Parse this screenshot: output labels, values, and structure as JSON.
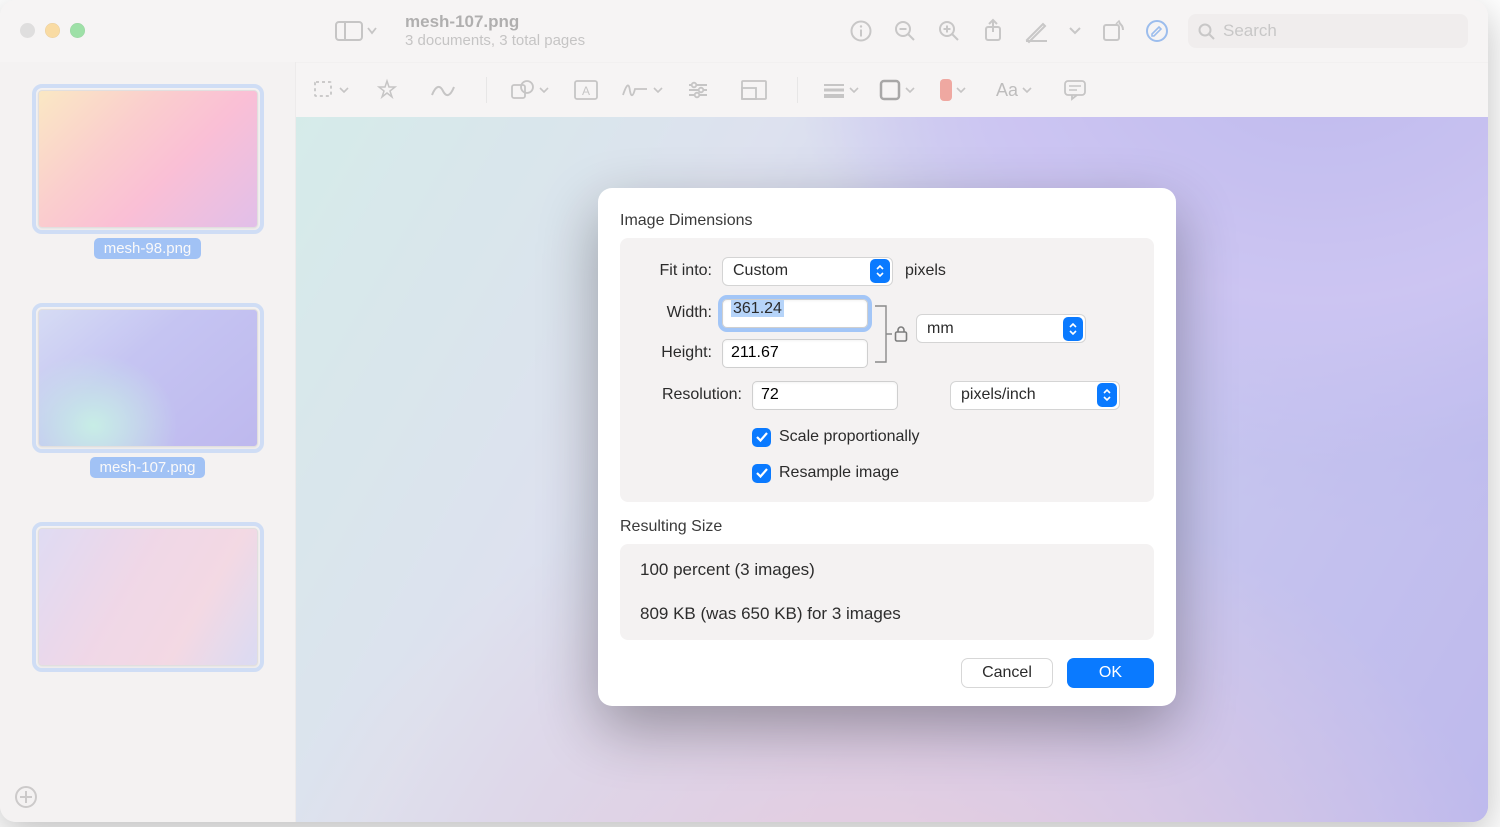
{
  "window": {
    "filename": "mesh-107.png",
    "subtitle": "3 documents, 3 total pages"
  },
  "toolbar_right": {
    "search_placeholder": "Search"
  },
  "sidebar": {
    "thumbs": [
      {
        "label": "mesh-98.png"
      },
      {
        "label": "mesh-107.png"
      },
      {
        "label": ""
      }
    ]
  },
  "dialog": {
    "section1_title": "Image Dimensions",
    "fit_into_label": "Fit into:",
    "fit_into_value": "Custom",
    "fit_into_unit": "pixels",
    "width_label": "Width:",
    "width_value": "361.24",
    "height_label": "Height:",
    "height_value": "211.67",
    "resolution_label": "Resolution:",
    "resolution_value": "72",
    "resolution_unit": "pixels/inch",
    "dimension_unit": "mm",
    "scale_label": "Scale proportionally",
    "resample_label": "Resample image",
    "section2_title": "Resulting Size",
    "result_line1": "100 percent (3 images)",
    "result_line2": "809 KB (was 650 KB) for 3 images",
    "cancel": "Cancel",
    "ok": "OK"
  },
  "markup": {
    "text_label": "Aa"
  }
}
